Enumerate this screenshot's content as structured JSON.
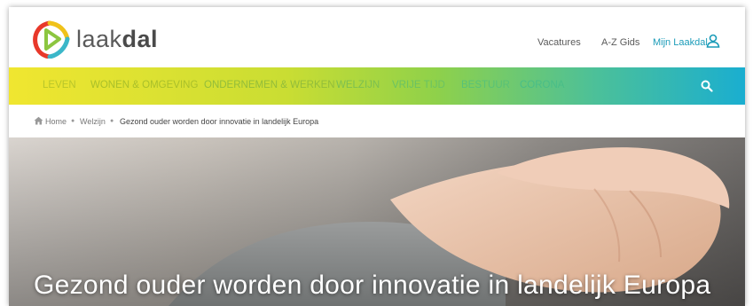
{
  "header": {
    "logo_text_light": "laak",
    "logo_text_bold": "dal",
    "links": {
      "vacatures": "Vacatures",
      "az": "A-Z Gids",
      "mijn": "Mijn Laakdal"
    }
  },
  "nav": {
    "items": [
      "LEVEN",
      "WONEN & OMGEVING",
      "ONDERNEMEN & WERKEN",
      "WELZIJN",
      "VRIJE TIJD",
      "BESTUUR",
      "CORONA"
    ]
  },
  "breadcrumb": {
    "items": [
      "Home",
      "Welzijn",
      "Gezond ouder worden door innovatie in landelijk Europa"
    ]
  },
  "hero": {
    "title": "Gezond ouder worden door innovatie in landelijk Europa"
  },
  "colors": {
    "accent": "#1a9bb8",
    "nav_start": "#f0e630",
    "nav_end": "#1aaed0"
  }
}
